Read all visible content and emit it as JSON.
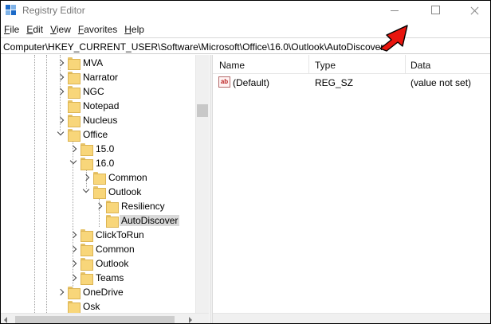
{
  "window": {
    "title": "Registry Editor",
    "caption_buttons": [
      "minimize-icon",
      "maximize-icon",
      "close-icon"
    ]
  },
  "menu": [
    {
      "accel": "F",
      "rest": "ile"
    },
    {
      "accel": "E",
      "rest": "dit"
    },
    {
      "accel": "V",
      "rest": "iew"
    },
    {
      "accel": "F",
      "rest": "avorites",
      "accel_index": 1
    },
    {
      "accel": "H",
      "rest": "elp"
    }
  ],
  "menu_labels": [
    "File",
    "Edit",
    "View",
    "Favorites",
    "Help"
  ],
  "address": {
    "path": "Computer\\HKEY_CURRENT_USER\\Software\\Microsoft\\Office\\16.0\\Outlook\\AutoDiscover"
  },
  "annotation": {
    "arrow_color": "#e8150e",
    "icon": "red-arrow-icon"
  },
  "tree": {
    "rows": [
      {
        "label": "MVA",
        "level": 0,
        "expander": "right"
      },
      {
        "label": "Narrator",
        "level": 0,
        "expander": "right"
      },
      {
        "label": "NGC",
        "level": 0,
        "expander": "right"
      },
      {
        "label": "Notepad",
        "level": 0,
        "expander": "none"
      },
      {
        "label": "Nucleus",
        "level": 0,
        "expander": "right"
      },
      {
        "label": "Office",
        "level": 0,
        "expander": "down"
      },
      {
        "label": "15.0",
        "level": 1,
        "expander": "right"
      },
      {
        "label": "16.0",
        "level": 1,
        "expander": "down"
      },
      {
        "label": "Common",
        "level": 2,
        "expander": "right"
      },
      {
        "label": "Outlook",
        "level": 2,
        "expander": "down"
      },
      {
        "label": "Resiliency",
        "level": 3,
        "expander": "right"
      },
      {
        "label": "AutoDiscover",
        "level": 3,
        "expander": "none",
        "selected": true
      },
      {
        "label": "ClickToRun",
        "level": 1,
        "expander": "right"
      },
      {
        "label": "Common",
        "level": 1,
        "expander": "right"
      },
      {
        "label": "Outlook",
        "level": 1,
        "expander": "right"
      },
      {
        "label": "Teams",
        "level": 1,
        "expander": "right"
      },
      {
        "label": "OneDrive",
        "level": 0,
        "expander": "right"
      },
      {
        "label": "Osk",
        "level": 0,
        "expander": "none"
      }
    ],
    "folder_color": "#f8d67a"
  },
  "list": {
    "columns": [
      "Name",
      "Type",
      "Data"
    ],
    "rows": [
      {
        "icon": "string-value-icon",
        "icon_text": "ab",
        "name": "(Default)",
        "type": "REG_SZ",
        "data": "(value not set)"
      }
    ]
  }
}
